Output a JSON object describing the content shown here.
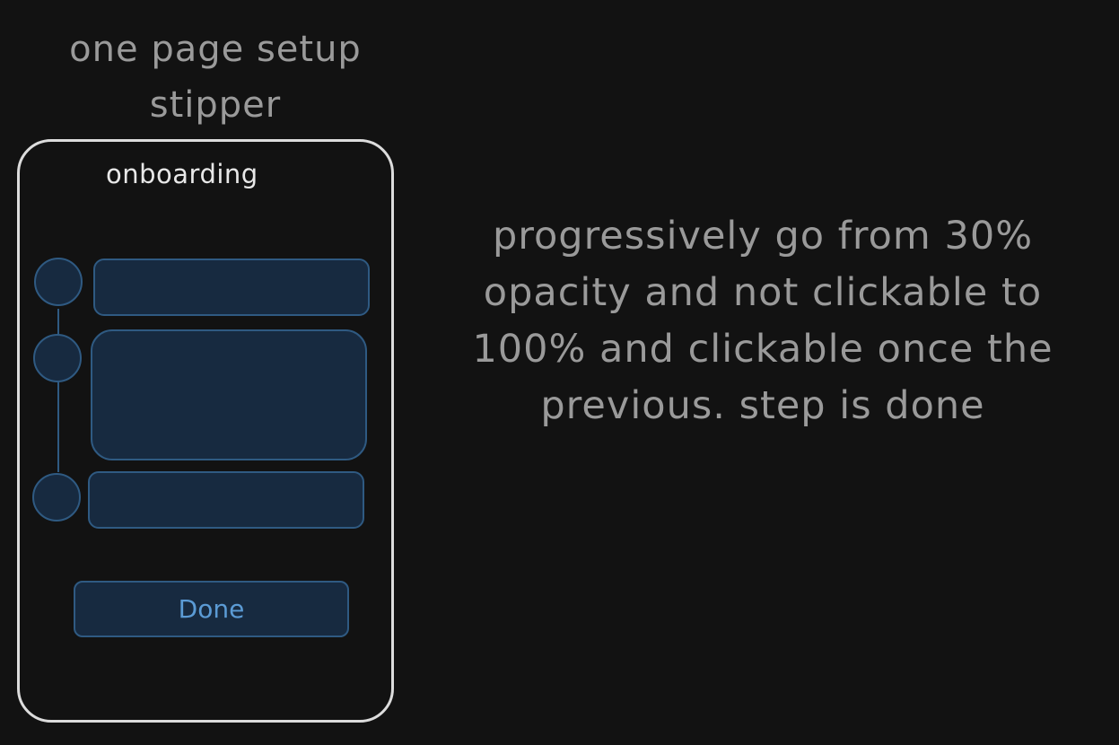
{
  "title": {
    "line1": "one page setup",
    "line2": "stipper"
  },
  "phone": {
    "heading": "onboarding",
    "steps": [
      {
        "id": 1
      },
      {
        "id": 2
      },
      {
        "id": 3
      }
    ],
    "done_label": "Done"
  },
  "note": {
    "lines": [
      "progressively go from 30%",
      "opacity and not clickable to",
      "100% and clickable once the",
      "previous. step is done"
    ]
  },
  "colors": {
    "background": "#121212",
    "muted_text": "#9a9a9a",
    "frame": "#dcdcdc",
    "step_fill": "#172a40",
    "step_border": "#2f5a82",
    "accent_text": "#5b9bd5"
  }
}
